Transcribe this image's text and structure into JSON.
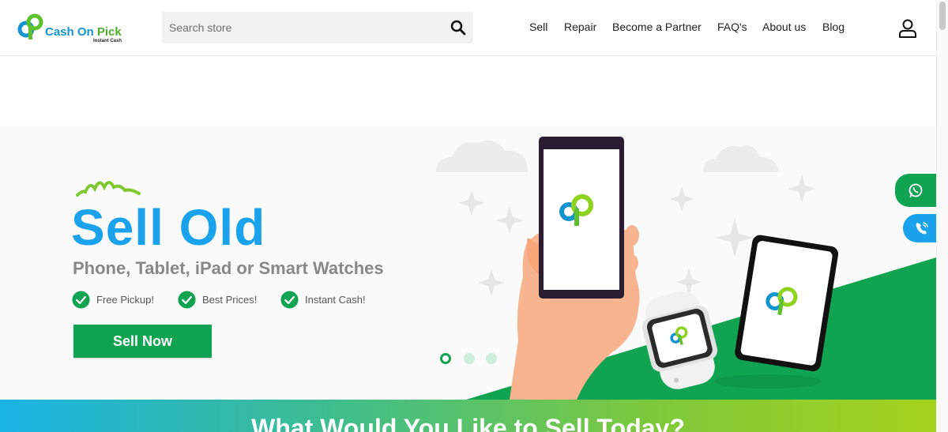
{
  "brand": {
    "name_part1": "Cash On",
    "name_part2": " Pick",
    "tagline": "Instant Cash",
    "colors": {
      "blue": "#1494cf",
      "green": "#4caf2a",
      "accent_green": "#0fa352",
      "hero_blue": "#1aa3ec"
    }
  },
  "search": {
    "placeholder": "Search store",
    "value": ""
  },
  "nav": [
    {
      "label": "Sell"
    },
    {
      "label": "Repair"
    },
    {
      "label": "Become a Partner"
    },
    {
      "label": "FAQ's"
    },
    {
      "label": "About us"
    },
    {
      "label": "Blog"
    }
  ],
  "icons": {
    "search": "search-icon",
    "user": "user-icon",
    "check": "check-circle-icon",
    "whatsapp": "whatsapp-icon",
    "phone": "phone-icon"
  },
  "hero": {
    "title": "Sell Old",
    "subtitle": "Phone, Tablet, iPad or Smart Watches",
    "features": [
      "Free Pickup!",
      "Best Prices!",
      "Instant Cash!"
    ],
    "cta": "Sell Now",
    "carousel": {
      "slides": 3,
      "active": 1
    }
  },
  "section": {
    "title": "What Would You Like to Sell Today?"
  }
}
